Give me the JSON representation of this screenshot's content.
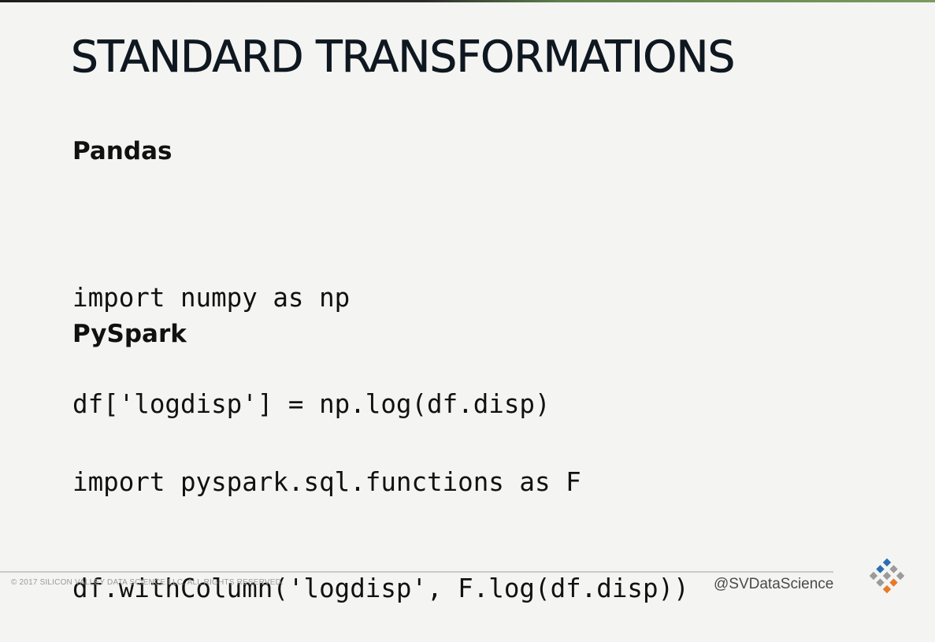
{
  "slide": {
    "title": "STANDARD TRANSFORMATIONS",
    "sections": [
      {
        "heading": "Pandas",
        "code": [
          "import numpy as np",
          "df['logdisp'] = np.log(df.disp)"
        ]
      },
      {
        "heading": "PySpark",
        "code": [
          "import pyspark.sql.functions as F",
          "df.withColumn('logdisp', F.log(df.disp))"
        ]
      }
    ]
  },
  "footer": {
    "copyright": "© 2017 SILICON VALLEY DATA SCIENCE LLC. ALL RIGHTS RESERVED.",
    "handle": "@SVDataScience"
  },
  "logo": {
    "icon": "svds-diamond-logo-icon",
    "colors": {
      "blue": "#2a6fb5",
      "orange": "#e8792a",
      "gray": "#9b9b9b"
    }
  }
}
